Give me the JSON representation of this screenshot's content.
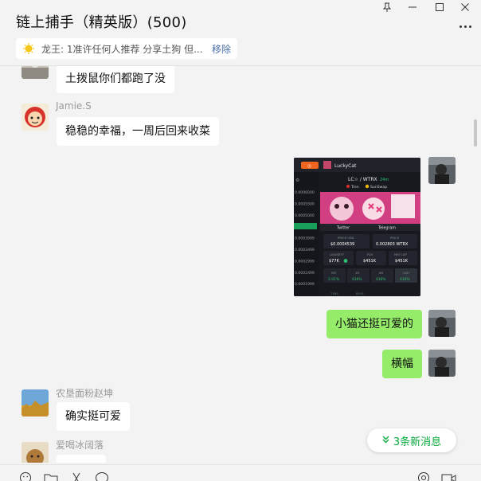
{
  "window": {
    "title": "链上捕手（精英版）(500)",
    "controls": {
      "pin": "⊥",
      "minimize": "—",
      "maximize": "☐",
      "close": "✕"
    }
  },
  "pinned": {
    "text": "龙王: 1准许任何人推荐 分享土狗 但...",
    "remove_label": "移除"
  },
  "messages": [
    {
      "sender": "",
      "text": "土拨鼠你们都跑了没",
      "direction": "in"
    },
    {
      "sender": "Jamie.S",
      "text": "稳稳的幸福，一周后回来收菜",
      "direction": "in"
    },
    {
      "sender": "",
      "text": "",
      "direction": "out",
      "type": "image"
    },
    {
      "sender": "",
      "text": "小猫还挺可爱的",
      "direction": "out"
    },
    {
      "sender": "",
      "text": "横幅",
      "direction": "out"
    },
    {
      "sender": "农垦面粉赵坤",
      "text": "确实挺可爱",
      "direction": "in"
    },
    {
      "sender": "爱喝冰阔落",
      "text": "",
      "direction": "in"
    }
  ],
  "shared_image": {
    "app_name": "LuckyCat",
    "pair": "LC☆ / WTRX",
    "pair_badge": "24m",
    "chain": "Tron",
    "dex": "SunSwap",
    "price_ticks": [
      "0.0006000",
      "0.0005500",
      "0.0005000",
      "0.0004539",
      "0.0003999",
      "0.0003499",
      "0.0002999",
      "0.0002499",
      "0.0001999"
    ],
    "links": [
      "Twitter",
      "Telegram"
    ],
    "price_usd_label": "PRICE USD",
    "price_usd": "$0.0004539",
    "price_label": "PRICE",
    "price": "0.002803 WTRX",
    "liquidity_label": "LIQUIDITY",
    "liquidity": "$77K",
    "fdv_label": "FDV",
    "fdv": "$451K",
    "mkt_cap_label": "MKT CAP",
    "mkt_cap": "$451K",
    "periods": [
      {
        "label": "5M",
        "value": "2.01%"
      },
      {
        "label": "1H",
        "value": "436%"
      },
      {
        "label": "6H",
        "value": "436%"
      },
      {
        "label": "24H",
        "value": "436%"
      }
    ],
    "bottom_labels": [
      "TXNS",
      "BUYS"
    ]
  },
  "new_messages": {
    "label": "3条新消息"
  },
  "colors": {
    "outgoing_bubble": "#95ec69",
    "accent_green": "#07a93a",
    "link_blue": "#4a6fa5"
  },
  "toolbar": [
    "emoji-icon",
    "folder-icon",
    "scissors-icon",
    "chat-icon",
    "history-icon",
    "video-icon"
  ]
}
